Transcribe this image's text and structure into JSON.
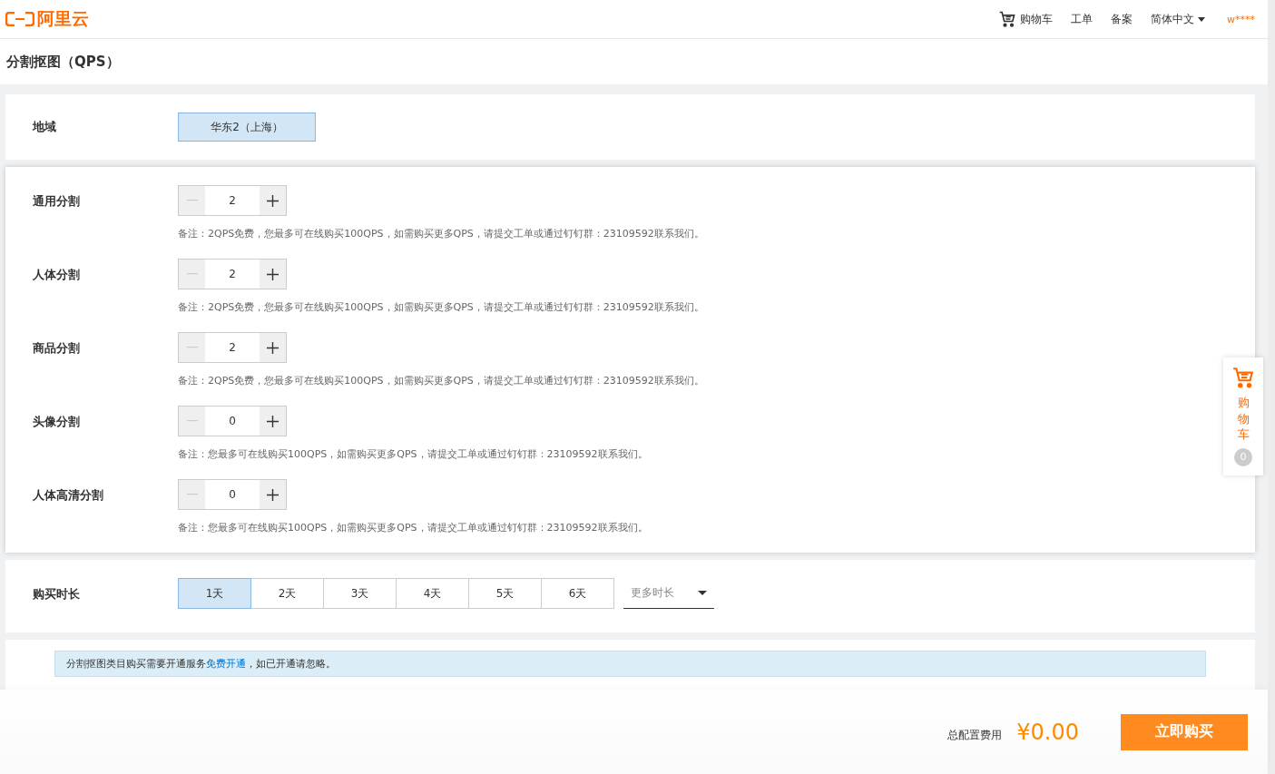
{
  "header": {
    "logo_text": "阿里云",
    "nav": [
      {
        "kind": "cart",
        "label": "购物车"
      },
      {
        "kind": "link",
        "label": "工单"
      },
      {
        "kind": "link",
        "label": "备案"
      },
      {
        "kind": "dropdown",
        "label": "简体中文"
      }
    ],
    "user": "w****"
  },
  "page_title": "分割抠图（QPS）",
  "region": {
    "label": "地域",
    "options": [
      {
        "label": "华东2（上海）",
        "selected": true
      }
    ]
  },
  "items": [
    {
      "label": "通用分割",
      "value": "2",
      "note": "备注：2QPS免费，您最多可在线购买100QPS，如需购买更多QPS，请提交工单或通过钉钉群：23109592联系我们。"
    },
    {
      "label": "人体分割",
      "value": "2",
      "note": "备注：2QPS免费，您最多可在线购买100QPS，如需购买更多QPS，请提交工单或通过钉钉群：23109592联系我们。"
    },
    {
      "label": "商品分割",
      "value": "2",
      "note": "备注：2QPS免费，您最多可在线购买100QPS，如需购买更多QPS，请提交工单或通过钉钉群：23109592联系我们。"
    },
    {
      "label": "头像分割",
      "value": "0",
      "note": "备注：您最多可在线购买100QPS，如需购买更多QPS，请提交工单或通过钉钉群：23109592联系我们。"
    },
    {
      "label": "人体高清分割",
      "value": "0",
      "note": "备注：您最多可在线购买100QPS，如需购买更多QPS，请提交工单或通过钉钉群：23109592联系我们。"
    }
  ],
  "duration": {
    "label": "购买时长",
    "options": [
      {
        "label": "1天",
        "selected": true
      },
      {
        "label": "2天",
        "selected": false
      },
      {
        "label": "3天",
        "selected": false
      },
      {
        "label": "4天",
        "selected": false
      },
      {
        "label": "5天",
        "selected": false
      },
      {
        "label": "6天",
        "selected": false
      }
    ],
    "more": "更多时长"
  },
  "notice": {
    "before": "分割抠图类目购买需要开通服务",
    "link": "免费开通",
    "after": "，如已开通请忽略。"
  },
  "side_cart": {
    "label": "购物车",
    "count": "0"
  },
  "footer": {
    "total_label": "总配置费用",
    "price": "¥0.00",
    "buy": "立即购买"
  }
}
